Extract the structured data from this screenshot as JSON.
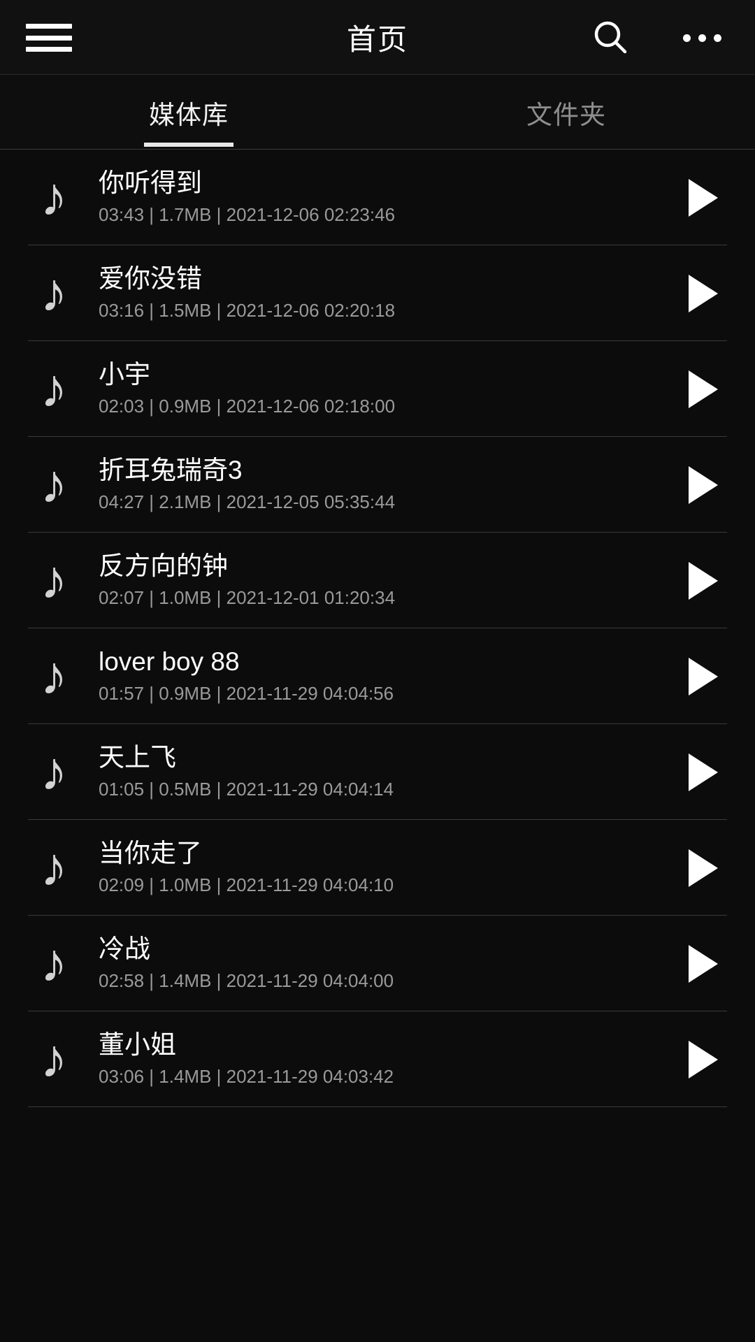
{
  "appbar": {
    "title": "首页",
    "menu_icon": "hamburger-menu-icon",
    "search_icon": "search-icon",
    "more_icon": "more-options-icon"
  },
  "tabs": {
    "items": [
      {
        "label": "媒体库",
        "active": true
      },
      {
        "label": "文件夹",
        "active": false
      }
    ]
  },
  "colors": {
    "background": "#0c0c0c",
    "appbar_background": "#111111",
    "title_text": "#ffffff",
    "meta_text": "#9a9a9a",
    "active_tab": "#f2f2f2",
    "inactive_tab": "#8e8e8e",
    "divider": "#3a3a3a",
    "accent_underline": "#e8e8e8"
  },
  "list": {
    "item_icon": "music-note-icon",
    "action_icon": "play-icon",
    "items": [
      {
        "title": "你听得到",
        "duration": "03:43",
        "size": "1.7MB",
        "date": "2021-12-06 02:23:46",
        "meta": "03:43 | 1.7MB | 2021-12-06 02:23:46"
      },
      {
        "title": "爱你没错",
        "duration": "03:16",
        "size": "1.5MB",
        "date": "2021-12-06 02:20:18",
        "meta": "03:16 | 1.5MB | 2021-12-06 02:20:18"
      },
      {
        "title": "小宇",
        "duration": "02:03",
        "size": "0.9MB",
        "date": "2021-12-06 02:18:00",
        "meta": "02:03 | 0.9MB | 2021-12-06 02:18:00"
      },
      {
        "title": "折耳兔瑞奇3",
        "duration": "04:27",
        "size": "2.1MB",
        "date": "2021-12-05 05:35:44",
        "meta": "04:27 | 2.1MB | 2021-12-05 05:35:44"
      },
      {
        "title": "反方向的钟",
        "duration": "02:07",
        "size": "1.0MB",
        "date": "2021-12-01 01:20:34",
        "meta": "02:07 | 1.0MB | 2021-12-01 01:20:34"
      },
      {
        "title": "lover boy 88",
        "duration": "01:57",
        "size": "0.9MB",
        "date": "2021-11-29 04:04:56",
        "meta": "01:57 | 0.9MB | 2021-11-29 04:04:56"
      },
      {
        "title": "天上飞",
        "duration": "01:05",
        "size": "0.5MB",
        "date": "2021-11-29 04:04:14",
        "meta": "01:05 | 0.5MB | 2021-11-29 04:04:14"
      },
      {
        "title": "当你走了",
        "duration": "02:09",
        "size": "1.0MB",
        "date": "2021-11-29 04:04:10",
        "meta": "02:09 | 1.0MB | 2021-11-29 04:04:10"
      },
      {
        "title": "冷战",
        "duration": "02:58",
        "size": "1.4MB",
        "date": "2021-11-29 04:04:00",
        "meta": "02:58 | 1.4MB | 2021-11-29 04:04:00"
      },
      {
        "title": "董小姐",
        "duration": "03:06",
        "size": "1.4MB",
        "date": "2021-11-29 04:03:42",
        "meta": "03:06 | 1.4MB | 2021-11-29 04:03:42"
      }
    ]
  }
}
